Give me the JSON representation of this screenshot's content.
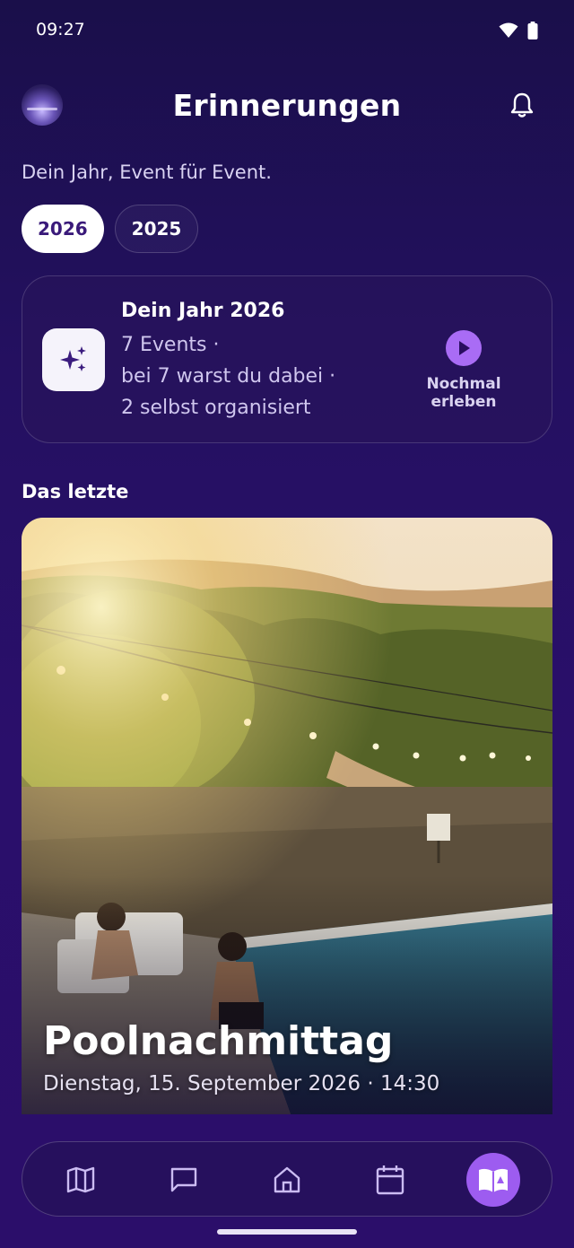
{
  "status_bar": {
    "time": "09:27"
  },
  "header": {
    "title": "Erinnerungen"
  },
  "subtitle": "Dein Jahr, Event für Event.",
  "years": [
    {
      "label": "2026",
      "active": true
    },
    {
      "label": "2025",
      "active": false
    }
  ],
  "recap": {
    "title": "Dein Jahr 2026",
    "lines": [
      "7 Events ·",
      "bei 7 warst du dabei ·",
      "2 selbst organisiert"
    ],
    "action_label": "Nochmal erleben"
  },
  "section_title": "Das letzte",
  "last_event": {
    "name": "Poolnachmittag",
    "date": "Dienstag, 15. September 2026 · 14:30"
  },
  "bottom_nav": {
    "items": [
      {
        "icon": "map-icon"
      },
      {
        "icon": "chat-icon"
      },
      {
        "icon": "home-icon"
      },
      {
        "icon": "calendar-icon"
      },
      {
        "icon": "memories-book-icon",
        "active": true
      }
    ]
  },
  "colors": {
    "accent": "#9d5cf0",
    "background": "#241061"
  }
}
